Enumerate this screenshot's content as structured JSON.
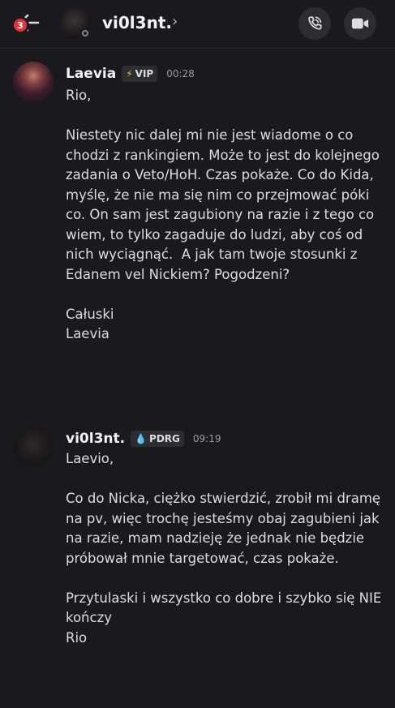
{
  "header": {
    "back_badge": "3",
    "channel_name": "vi0l3nt.",
    "chevron": "›",
    "call_icon": "phone-call-icon",
    "video_icon": "video-camera-icon"
  },
  "messages": [
    {
      "author": "Laevia",
      "tag_icon": "⚡",
      "tag": "VIP",
      "time": "00:28",
      "text": "Rio,\n\nNiestety nic dalej mi nie jest wiadome o co chodzi z rankingiem. Może to jest do kolejnego zadania o Veto/HoH. Czas pokaże. Co do Kida, myślę, że nie ma się nim co przejmować póki co. On sam jest zagubiony na razie i z tego co wiem, to tylko zagaduje do ludzi, aby coś od nich wyciągnąć.  A jak tam twoje stosunki z Edanem vel Nickiem? Pogodzeni?\n\nCałuski\nLaevia"
    },
    {
      "author": "vi0l3nt.",
      "tag_icon": "💧",
      "tag": "PDRG",
      "time": "09:19",
      "text": "Laevio,\n\nCo do Nicka, ciężko stwierdzić, zrobił mi dramę na pv, więc trochę jesteśmy obaj zagubieni jak na razie, mam nadzieję że jednak nie będzie próbował mnie targetować, czas pokaże.\n\nPrzytulaski i wszystko co dobre i szybko się NIE kończy\nRio"
    }
  ],
  "colors": {
    "background": "#1a1a1e",
    "badge": "#e0353d",
    "text": "#dbdee1",
    "muted": "#949ba4"
  }
}
